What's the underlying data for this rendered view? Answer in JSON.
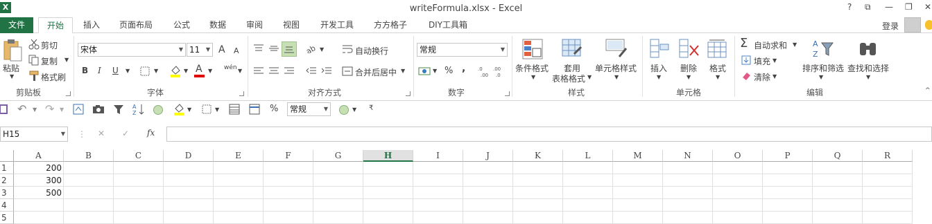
{
  "window": {
    "title": "writeFormula.xlsx - Excel",
    "help": "?",
    "restore": "⧉",
    "minimize": "—",
    "maximize": "❐",
    "close": "✕"
  },
  "tabs": [
    "文件",
    "开始",
    "插入",
    "页面布局",
    "公式",
    "数据",
    "审阅",
    "视图",
    "开发工具",
    "方方格子",
    "DIY工具箱"
  ],
  "account": {
    "login": "登录"
  },
  "ribbon": {
    "clipboard": {
      "paste": "粘贴",
      "cut": "剪切",
      "copy": "复制",
      "format_painter": "格式刷",
      "label": "剪贴板"
    },
    "font": {
      "name": "宋体",
      "size": "11",
      "grow": "A",
      "shrink": "A",
      "bold": "B",
      "italic": "I",
      "underline": "U",
      "wen": "wén",
      "label": "字体"
    },
    "alignment": {
      "wrap": "自动换行",
      "merge": "合并后居中",
      "label": "对齐方式"
    },
    "number": {
      "format": "常规",
      "percent": "%",
      "comma": ",",
      "label": "数字"
    },
    "styles": {
      "conditional": "条件格式",
      "table1": "套用",
      "table2": "表格格式",
      "cell_styles": "单元格样式",
      "label": "样式"
    },
    "cells": {
      "insert": "插入",
      "delete": "删除",
      "format": "格式",
      "label": "单元格"
    },
    "editing": {
      "autosum": "自动求和",
      "fill": "填充",
      "clear": "清除",
      "sort": "排序和筛选",
      "find": "查找和选择",
      "label": "编辑"
    }
  },
  "qat": {
    "format": "常规",
    "percent": "%"
  },
  "formula_bar": {
    "name_box": "H15",
    "fx": "fx",
    "cancel": "✕",
    "enter": "✓",
    "value": ""
  },
  "sheet": {
    "columns": [
      "A",
      "B",
      "C",
      "D",
      "E",
      "F",
      "G",
      "H",
      "I",
      "J",
      "K",
      "L",
      "M",
      "N",
      "O",
      "P",
      "Q",
      "R"
    ],
    "selected_column": "H",
    "rows": [
      "1",
      "2",
      "3",
      "4",
      "5"
    ],
    "cells": {
      "A1": "200",
      "A2": "300",
      "A3": "500"
    }
  },
  "colors": {
    "accent": "#217346"
  }
}
